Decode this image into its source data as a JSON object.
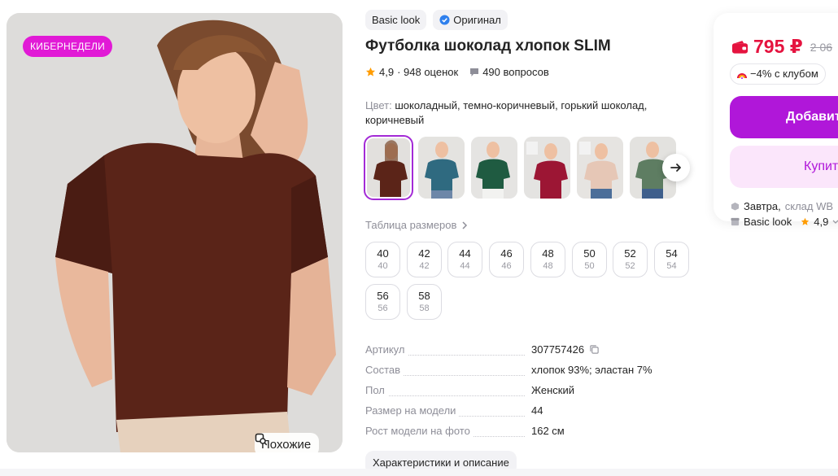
{
  "product": {
    "badge_sale": "КИБЕРНЕДЕЛИ",
    "similar_label": "Похожие",
    "brand_chip": "Basic look",
    "original_chip": "Оригинал",
    "title": "Футболка шоколад хлопок SLIM",
    "rating": "4,9",
    "reviews": "· 948 оценок",
    "questions": "490 вопросов",
    "color_label": "Цвет:",
    "color_value": "шоколадный, темно-коричневый, горький шоколад, коричневый",
    "thumbnails": [
      {
        "name": "chocolate",
        "color": "#5b2418",
        "active": true
      },
      {
        "name": "teal",
        "color": "#2f6a80",
        "active": false
      },
      {
        "name": "green",
        "color": "#1f5b41",
        "active": false
      },
      {
        "name": "raspberry",
        "color": "#9c1634",
        "active": false
      },
      {
        "name": "beige",
        "color": "#e6c7b6",
        "active": false
      },
      {
        "name": "sage",
        "color": "#5e7d62",
        "active": false
      }
    ],
    "size_table_label": "Таблица размеров",
    "sizes": [
      {
        "main": "40",
        "sub": "40"
      },
      {
        "main": "42",
        "sub": "42"
      },
      {
        "main": "44",
        "sub": "44"
      },
      {
        "main": "46",
        "sub": "46"
      },
      {
        "main": "48",
        "sub": "48"
      },
      {
        "main": "50",
        "sub": "50"
      },
      {
        "main": "52",
        "sub": "52"
      },
      {
        "main": "54",
        "sub": "54"
      },
      {
        "main": "56",
        "sub": "56"
      },
      {
        "main": "58",
        "sub": "58"
      }
    ],
    "properties": [
      {
        "key": "Артикул",
        "value": "307757426"
      },
      {
        "key": "Состав",
        "value": "хлопок 93%; эластан 7%"
      },
      {
        "key": "Пол",
        "value": "Женский"
      },
      {
        "key": "Размер на модели",
        "value": "44"
      },
      {
        "key": "Рост модели на фото",
        "value": "162 см"
      }
    ],
    "description_button": "Характеристики и описание"
  },
  "buy_card": {
    "price": "795 ₽",
    "old_price": "2 06",
    "club_discount": "−4% с клубом",
    "add_button": "Добавит",
    "buy_button": "Купит",
    "delivery_day": "Завтра,",
    "delivery_warehouse": "склад WB",
    "seller_name": "Basic look",
    "seller_rating": "4,9"
  },
  "colors": {
    "accent": "#b017d9",
    "sale_badge": "#e11ad6",
    "price": "#e5133f",
    "star": "#ff9c00"
  }
}
